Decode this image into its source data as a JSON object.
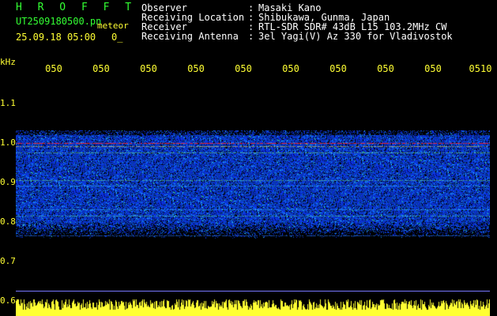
{
  "header": {
    "brand": "H R O F F T",
    "filename": "UT2509180500.pn",
    "meteor_label": "meteor",
    "datetime": "25.09.18 05:00",
    "count": "0_"
  },
  "info": [
    {
      "label": "Observer",
      "sep": ":",
      "value": "Masaki Kano"
    },
    {
      "label": "Receiving Location",
      "sep": ":",
      "value": "Shibukawa, Gunma, Japan"
    },
    {
      "label": "Receiver",
      "sep": ":",
      "value": "RTL-SDR SDR# 43dB L15 103.2MHz CW"
    },
    {
      "label": "Receiving Antenna",
      "sep": ":",
      "value": "3el Yagi(V) Az 330 for Vladivostok"
    }
  ],
  "axis": {
    "y_unit": "kHz",
    "time_ticks": [
      "050",
      "050",
      "050",
      "050",
      "050",
      "050",
      "050",
      "050",
      "050",
      "0510"
    ],
    "freq_ticks": [
      "1.1",
      "1.0",
      "0.9",
      "0.8",
      "0.7",
      "0.6"
    ]
  },
  "colors": {
    "background": "#000000",
    "header_green": "#33ff33",
    "text_yellow": "#ffff33",
    "text_white": "#ffffff",
    "signal_red": "#ff2020",
    "noise_blue": "#1a3cff"
  }
}
